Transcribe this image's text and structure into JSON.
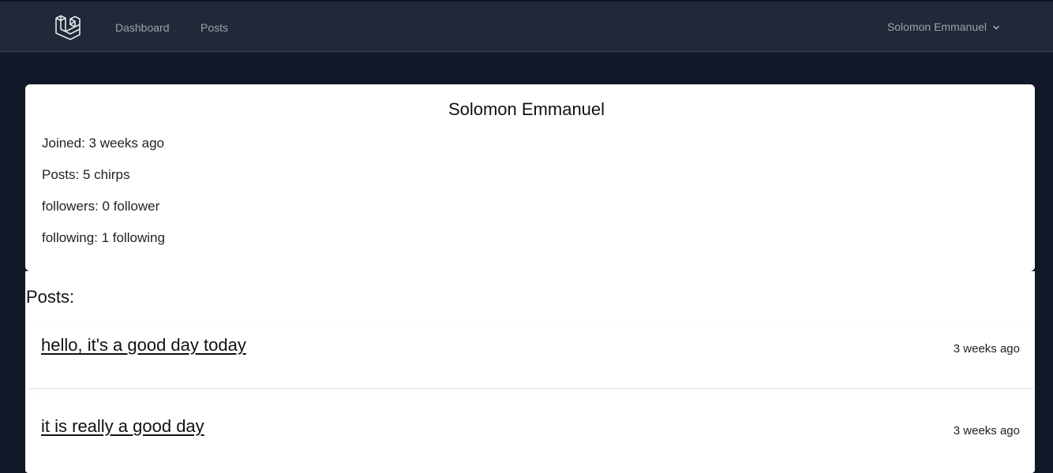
{
  "nav": {
    "logo_icon": "laravel-logo-icon",
    "links": [
      {
        "label": "Dashboard"
      },
      {
        "label": "Posts"
      }
    ],
    "user_name": "Solomon Emmanuel",
    "user_menu_icon": "chevron-down-icon"
  },
  "profile": {
    "name": "Solomon Emmanuel",
    "joined": "Joined: 3 weeks ago",
    "posts": "Posts: 5 chirps",
    "followers": "followers: 0 follower",
    "following": "following: 1 following"
  },
  "posts_section": {
    "heading": "Posts:",
    "items": [
      {
        "title": "hello, it's a good day today",
        "time": "3 weeks ago"
      },
      {
        "title": "it is really a good day",
        "time": "3 weeks ago"
      }
    ]
  },
  "colors": {
    "page_bg": "#111827",
    "nav_bg": "#1f2937",
    "nav_text": "#9ca3af",
    "card_bg": "#ffffff"
  }
}
